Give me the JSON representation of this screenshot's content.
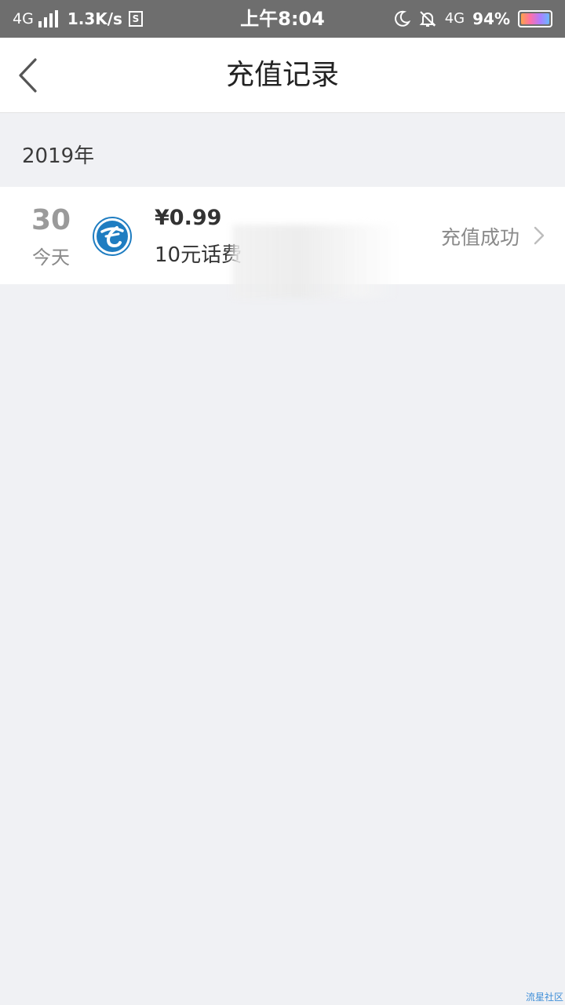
{
  "status_bar": {
    "network_left": "4G",
    "speed": "1.3K/s",
    "s_icon": "S",
    "time": "上午8:04",
    "network_right": "4G",
    "battery": "94%",
    "icons": [
      "signal-icon",
      "s-box-icon",
      "moon-icon",
      "bell-off-icon",
      "battery-icon"
    ]
  },
  "header": {
    "title": "充值记录",
    "back_icon": "chevron-left-icon"
  },
  "list": {
    "year": "2019年",
    "records": [
      {
        "day": "30",
        "day_label": "今天",
        "amount": "¥0.99",
        "product": "10元话费",
        "status": "充值成功",
        "logo_icon": "china-telecom-logo-icon",
        "chevron_icon": "chevron-right-icon"
      }
    ]
  },
  "watermark": "流星社区",
  "colors": {
    "status_bar_bg": "#6e6e6e",
    "page_bg": "#f0f1f4",
    "card_bg": "#ffffff",
    "logo_blue": "#1f7dc1"
  }
}
